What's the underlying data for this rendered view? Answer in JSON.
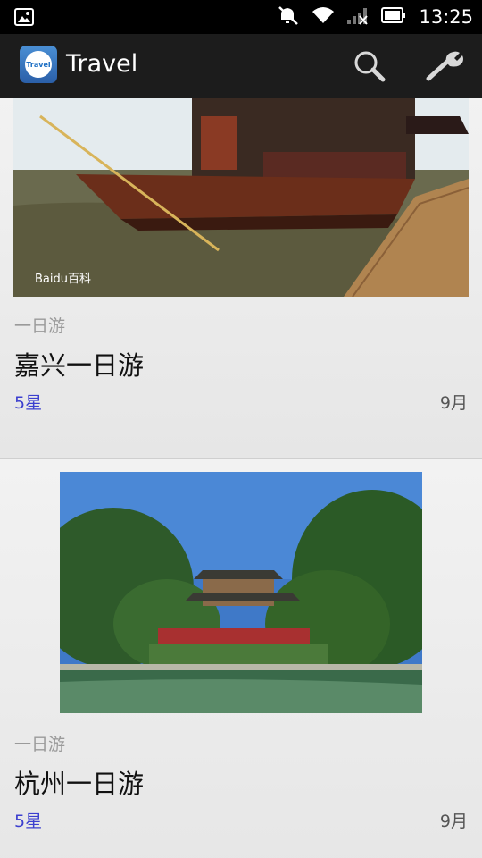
{
  "status_bar": {
    "time": "13:25",
    "icons": [
      "image-notification-icon",
      "mute-icon",
      "wifi-icon",
      "signal-icon",
      "battery-icon"
    ]
  },
  "action_bar": {
    "logo_text": "Travel",
    "title": "Travel",
    "icons": [
      "search-icon",
      "wrench-icon"
    ]
  },
  "cards": [
    {
      "image": "boat-on-lake-photo",
      "watermark": "Baidu百科",
      "category": "一日游",
      "title": "嘉兴一日游",
      "rating": "5星",
      "month": "9月"
    },
    {
      "image": "pavilion-by-lake-photo",
      "category": "一日游",
      "title": "杭州一日游",
      "rating": "5星",
      "month": "9月"
    }
  ],
  "colors": {
    "status_bar_bg": "#000000",
    "action_bar_bg": "#1c1c1c",
    "rating_text": "#3c3fcf",
    "category_text": "#9a9a9a"
  }
}
